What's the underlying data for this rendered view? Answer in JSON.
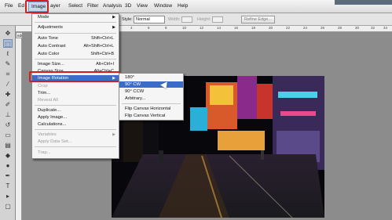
{
  "menubar": {
    "items": [
      "File",
      "Ed",
      "Image",
      "ayer",
      "Select",
      "Filter",
      "Analysis",
      "3D",
      "View",
      "Window",
      "Help"
    ]
  },
  "options": {
    "style_label": "Style:",
    "style_value": "Normal",
    "width_label": "Width:",
    "height_label": "Height:",
    "refine_button": "Refine Edge..."
  },
  "doc_tab": "edit",
  "ruler": {
    "numbers": [
      "4",
      "2",
      "0",
      "2",
      "4",
      "6",
      "8",
      "10",
      "12",
      "14",
      "16",
      "18",
      "20",
      "22",
      "24",
      "26",
      "28",
      "30",
      "32",
      "34"
    ]
  },
  "image_menu": {
    "items": [
      {
        "label": "Mode",
        "shortcut": "",
        "arrow": true,
        "disabled": false
      },
      {
        "label": "Adjustments",
        "shortcut": "",
        "arrow": true,
        "disabled": false
      },
      {
        "label": "Auto Tone",
        "shortcut": "Shift+Ctrl+L",
        "arrow": false,
        "disabled": false
      },
      {
        "label": "Auto Contrast",
        "shortcut": "Alt+Shift+Ctrl+L",
        "arrow": false,
        "disabled": false
      },
      {
        "label": "Auto Color",
        "shortcut": "Shift+Ctrl+B",
        "arrow": false,
        "disabled": false
      },
      {
        "label": "Image Size...",
        "shortcut": "Alt+Ctrl+I",
        "arrow": false,
        "disabled": false
      },
      {
        "label": "Canvas Size...",
        "shortcut": "Alt+Ctrl+C",
        "arrow": false,
        "disabled": false
      },
      {
        "label": "Image Rotation",
        "shortcut": "",
        "arrow": true,
        "disabled": false
      },
      {
        "label": "Crop",
        "shortcut": "",
        "arrow": false,
        "disabled": true
      },
      {
        "label": "Trim...",
        "shortcut": "",
        "arrow": false,
        "disabled": false
      },
      {
        "label": "Reveal All",
        "shortcut": "",
        "arrow": false,
        "disabled": true
      },
      {
        "label": "Duplicate...",
        "shortcut": "",
        "arrow": false,
        "disabled": false
      },
      {
        "label": "Apply Image...",
        "shortcut": "",
        "arrow": false,
        "disabled": false
      },
      {
        "label": "Calculations...",
        "shortcut": "",
        "arrow": false,
        "disabled": false
      },
      {
        "label": "Variables",
        "shortcut": "",
        "arrow": true,
        "disabled": true
      },
      {
        "label": "Apply Data Set...",
        "shortcut": "",
        "arrow": false,
        "disabled": true
      },
      {
        "label": "Trap...",
        "shortcut": "",
        "arrow": false,
        "disabled": true
      }
    ]
  },
  "rotation_menu": {
    "items": [
      {
        "label": "180°"
      },
      {
        "label": "90° CW"
      },
      {
        "label": "90° CCW"
      },
      {
        "label": "Arbitrary..."
      },
      {
        "label": "Flip Canvas Horizontal"
      },
      {
        "label": "Flip Canvas Vertical"
      }
    ]
  }
}
